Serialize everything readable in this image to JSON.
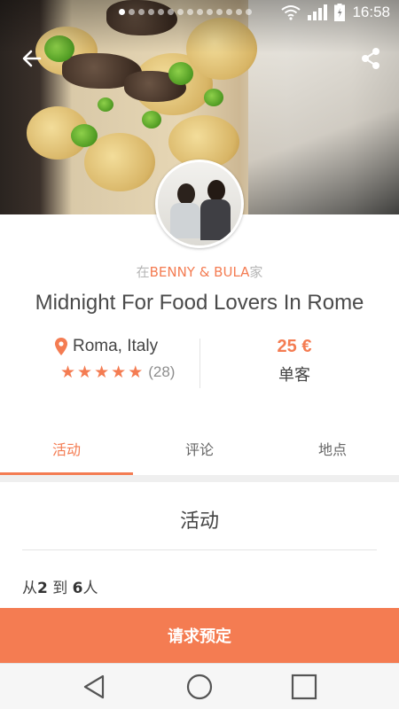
{
  "status_bar": {
    "time": "16:58",
    "icons": [
      "wifi-icon",
      "signal-icon",
      "battery-icon"
    ],
    "page_dots_total": 14,
    "page_dot_active": 0
  },
  "header": {
    "back_icon": "arrow-left-icon",
    "share_icon": "share-icon"
  },
  "host": {
    "prefix": "在",
    "name": "BENNY & BULA",
    "suffix": "家"
  },
  "event": {
    "title": "Midnight For Food Lovers In Rome",
    "location": "Roma, Italy",
    "rating_stars": 5,
    "rating_count": "(28)",
    "price": "25 €",
    "price_unit": "单客"
  },
  "tabs": [
    {
      "label": "活动",
      "active": true
    },
    {
      "label": "评论",
      "active": false
    },
    {
      "label": "地点",
      "active": false
    }
  ],
  "section": {
    "title": "活动",
    "party_from": "从",
    "party_min": "2",
    "party_to": " 到 ",
    "party_max": "6",
    "party_unit": "人"
  },
  "cta": {
    "label": "请求预定"
  },
  "colors": {
    "accent": "#f47c52",
    "text": "#444444",
    "muted": "#b5b5b5"
  }
}
